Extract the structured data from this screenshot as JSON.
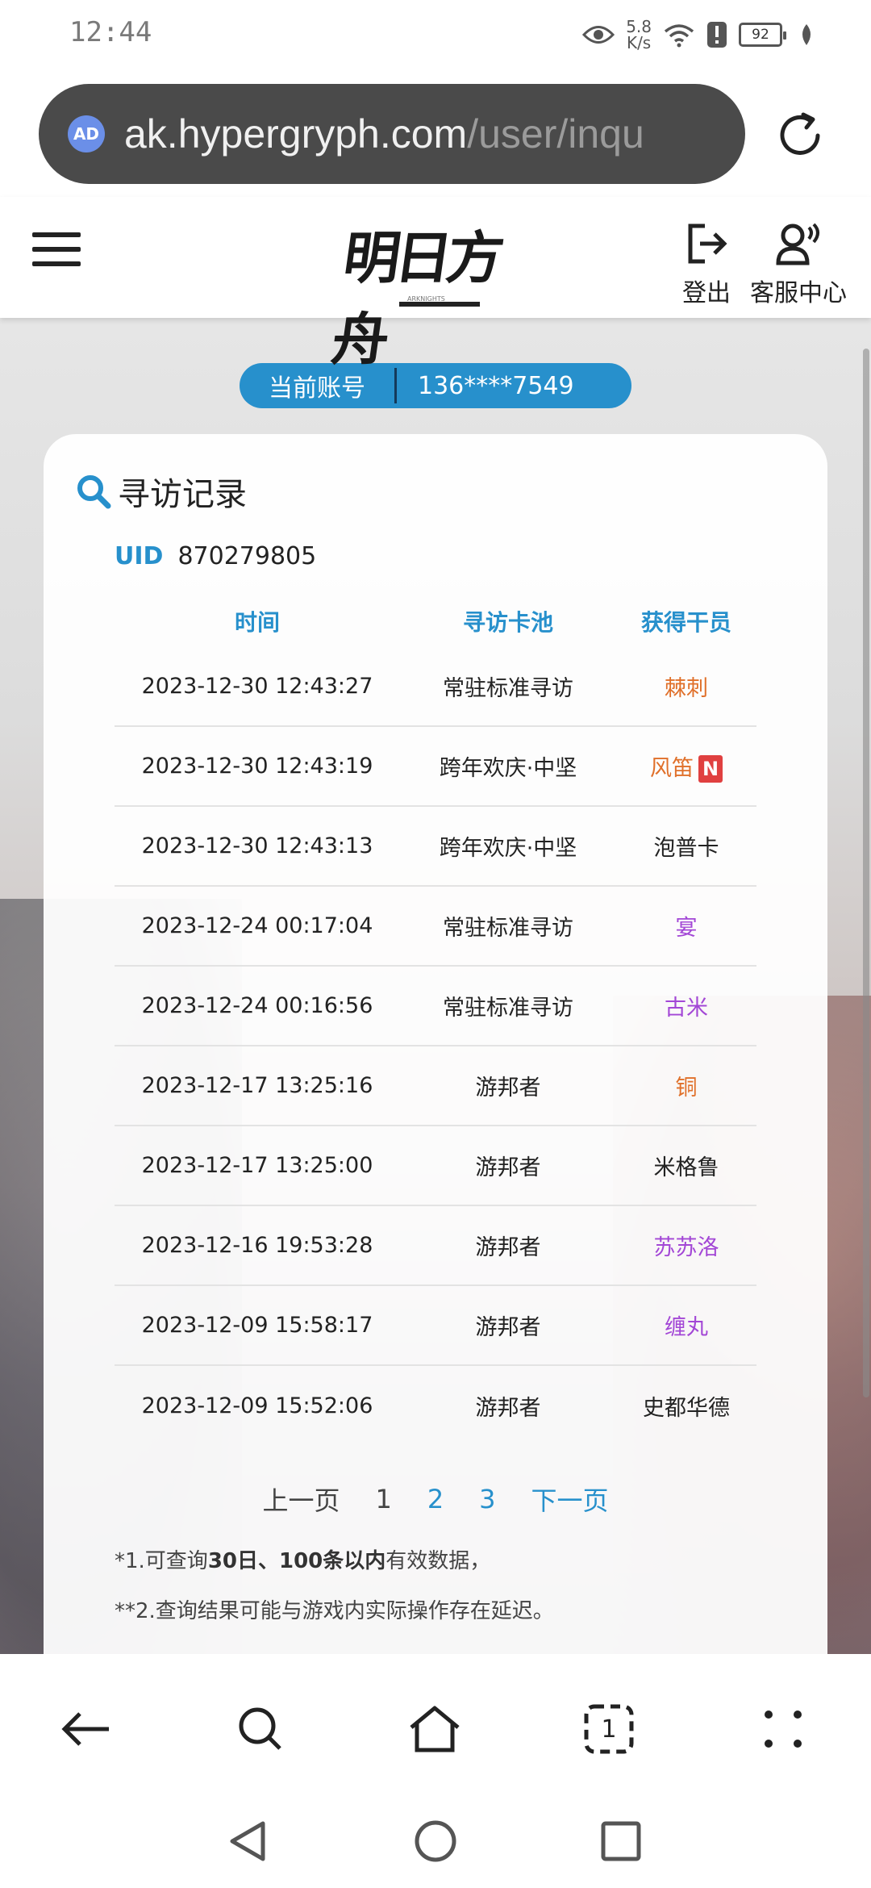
{
  "status_bar": {
    "time": "12:44",
    "net_speed_value": "5.8",
    "net_speed_unit": "K/s",
    "battery": "92"
  },
  "browser": {
    "url_host": "ak.hypergryph.com",
    "url_path": "/user/inqu",
    "ad_badge": "AD"
  },
  "header": {
    "logo_text": "明日方舟",
    "logo_sub": "ARKNIGHTS",
    "logout_label": "登出",
    "service_label": "客服中心"
  },
  "account": {
    "label": "当前账号",
    "value": "136****7549"
  },
  "card": {
    "title": "寻访记录",
    "uid_label": "UID",
    "uid_value": "870279805",
    "columns": [
      "时间",
      "寻访卡池",
      "获得干员"
    ],
    "rows": [
      {
        "time": "2023-12-30 12:43:27",
        "pool": "常驻标准寻访",
        "operator": "棘刺",
        "color": "#e0702a",
        "new": false
      },
      {
        "time": "2023-12-30 12:43:19",
        "pool": "跨年欢庆·中坚",
        "operator": "风笛",
        "color": "#e0702a",
        "new": true
      },
      {
        "time": "2023-12-30 12:43:13",
        "pool": "跨年欢庆·中坚",
        "operator": "泡普卡",
        "color": "#222222",
        "new": false
      },
      {
        "time": "2023-12-24 00:17:04",
        "pool": "常驻标准寻访",
        "operator": "宴",
        "color": "#a347d6",
        "new": false
      },
      {
        "time": "2023-12-24 00:16:56",
        "pool": "常驻标准寻访",
        "operator": "古米",
        "color": "#a347d6",
        "new": false
      },
      {
        "time": "2023-12-17 13:25:16",
        "pool": "游邦者",
        "operator": "铜",
        "color": "#e0702a",
        "new": false
      },
      {
        "time": "2023-12-17 13:25:00",
        "pool": "游邦者",
        "operator": "米格鲁",
        "color": "#222222",
        "new": false
      },
      {
        "time": "2023-12-16 19:53:28",
        "pool": "游邦者",
        "operator": "苏苏洛",
        "color": "#a347d6",
        "new": false
      },
      {
        "time": "2023-12-09 15:58:17",
        "pool": "游邦者",
        "operator": "缠丸",
        "color": "#a347d6",
        "new": false
      },
      {
        "time": "2023-12-09 15:52:06",
        "pool": "游邦者",
        "operator": "史都华德",
        "color": "#222222",
        "new": false
      }
    ],
    "new_badge": "N",
    "pager": {
      "prev": "上一页",
      "pages": [
        "1",
        "2",
        "3"
      ],
      "next": "下一页"
    },
    "note1_prefix": "*1.可查询",
    "note1_bold": "30日、100条以内",
    "note1_suffix": "有效数据，",
    "note2": "**2.查询结果可能与游戏内实际操作存在延迟。"
  },
  "toolbar": {
    "tab_count": "1"
  },
  "colors": {
    "accent": "#2790cc",
    "six_star": "#e0702a",
    "five_star": "#a347d6",
    "new_badge": "#e04040"
  }
}
